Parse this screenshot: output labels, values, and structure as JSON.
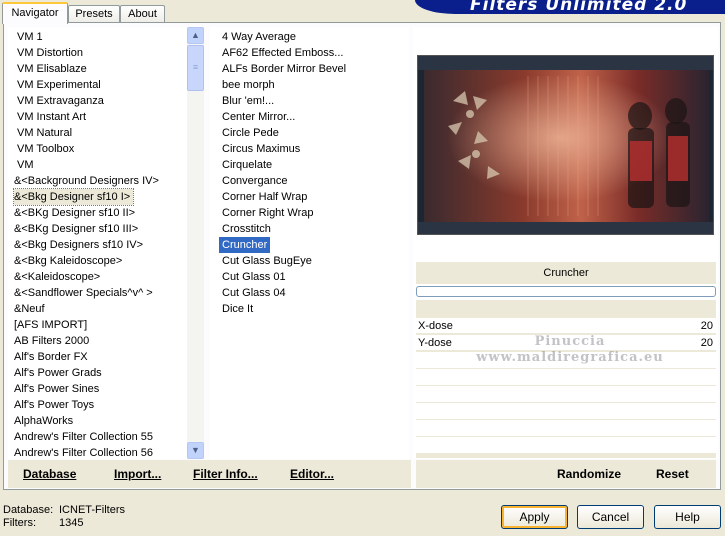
{
  "app": {
    "title": "Filters Unlimited 2.0"
  },
  "tabs": [
    {
      "label": "Navigator",
      "active": true
    },
    {
      "label": "Presets",
      "active": false
    },
    {
      "label": "About",
      "active": false
    }
  ],
  "categories": [
    "VM 1",
    "VM Distortion",
    "VM Elisablaze",
    "VM Experimental",
    "VM Extravaganza",
    "VM Instant Art",
    "VM Natural",
    "VM Toolbox",
    "VM",
    "&<Background Designers IV>",
    "&<Bkg Designer sf10 I>",
    "&<BKg Designer sf10 II>",
    "&<BKg Designer sf10 III>",
    "&<Bkg Designers sf10 IV>",
    "&<Bkg Kaleidoscope>",
    "&<Kaleidoscope>",
    "&<Sandflower Specials^v^ >",
    "&Neuf",
    "[AFS IMPORT]",
    "AB Filters 2000",
    "Alf's Border FX",
    "Alf's Power Grads",
    "Alf's Power Sines",
    "Alf's Power Toys",
    "AlphaWorks",
    "Andrew's Filter Collection 55",
    "Andrew's Filter Collection 56"
  ],
  "selected_category": "&<Bkg Designer sf10 I>",
  "filters": [
    "4 Way Average",
    "AF62 Effected Emboss...",
    "ALFs Border Mirror Bevel",
    "bee morph",
    "Blur 'em!...",
    "Center Mirror...",
    "Circle Pede",
    "Circus Maximus",
    "Cirquelate",
    "Convergance",
    "Corner Half Wrap",
    "Corner Right Wrap",
    "Crosstitch",
    "Cruncher",
    "Cut Glass  BugEye",
    "Cut Glass 01",
    "Cut Glass 04",
    "Dice It"
  ],
  "selected_filter": "Cruncher",
  "preview": {
    "filter_name": "Cruncher"
  },
  "parameters": [
    {
      "label": "X-dose",
      "value": "20"
    },
    {
      "label": "Y-dose",
      "value": "20"
    }
  ],
  "watermark": {
    "line1": "Pinuccia",
    "line2": "www.maldiregrafica.eu"
  },
  "toolbar": {
    "database": "Database",
    "import": "Import...",
    "filter_info": "Filter Info...",
    "editor": "Editor...",
    "randomize": "Randomize",
    "reset": "Reset"
  },
  "status": {
    "database_label": "Database:",
    "database_value": "ICNET-Filters",
    "filters_label": "Filters:",
    "filters_value": "1345"
  },
  "buttons": {
    "apply": "Apply",
    "cancel": "Cancel",
    "help": "Help"
  },
  "colors": {
    "selection": "#316ac5",
    "banner": "#0a1e8c",
    "dialog_bg": "#ece9d8"
  }
}
